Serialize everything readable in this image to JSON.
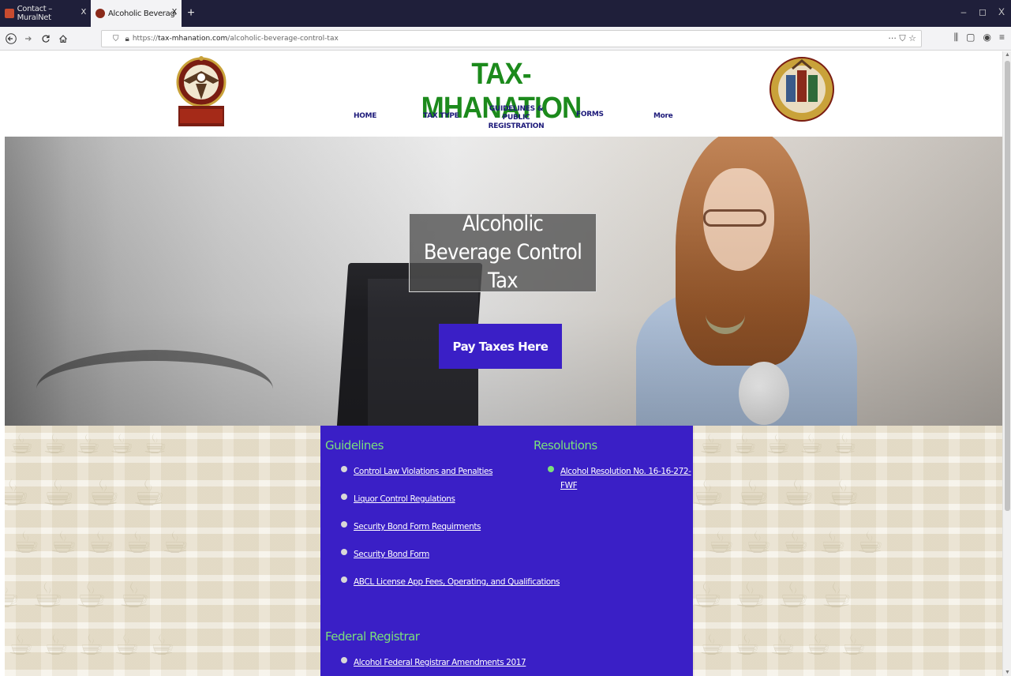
{
  "browser": {
    "tabs": [
      {
        "title": "Contact – MuralNet",
        "close": "X"
      },
      {
        "title": "Alcoholic Beverage Control Tax",
        "close": "X"
      }
    ],
    "new_tab": "+",
    "window_controls": [
      "–",
      "◻",
      "X"
    ],
    "url": {
      "prefix": "https://",
      "host": "tax-mhanation.com",
      "path": "/alcoholic-beverage-control-tax"
    },
    "url_actions": "··· ⛉ ☆",
    "toolbar_icons": [
      "⫼",
      "▢",
      "◉",
      "≡"
    ]
  },
  "site": {
    "title": "TAX-MHANATION",
    "nav": [
      {
        "label": "HOME"
      },
      {
        "label": "TAX TYPE"
      },
      {
        "label": "GUIDELINES & PUBLIC REGISTRATION"
      },
      {
        "label": "FORMS"
      },
      {
        "label": "More"
      }
    ]
  },
  "hero": {
    "title": "Alcoholic Beverage Control Tax",
    "button": "Pay Taxes Here"
  },
  "guidelines": {
    "title": "Guidelines",
    "items": [
      "Control Law Violations and Penalties",
      "Liquor Control Regulations",
      "Security Bond Form Requirments",
      "Security Bond Form",
      "ABCL License App Fees, Operating, and Qualifications"
    ]
  },
  "resolutions": {
    "title": "Resolutions",
    "items": [
      "Alcohol Resolution No. 16-16-272-FWF"
    ]
  },
  "federal": {
    "title": "Federal Registrar",
    "items": [
      "Alcohol Federal Registrar Amendments 2017"
    ]
  },
  "colors": {
    "site_title": "#1c8a1c",
    "nav_text": "#1d1a7a",
    "accent_purple": "#3a1fc6",
    "section_heading": "#7be07b"
  }
}
